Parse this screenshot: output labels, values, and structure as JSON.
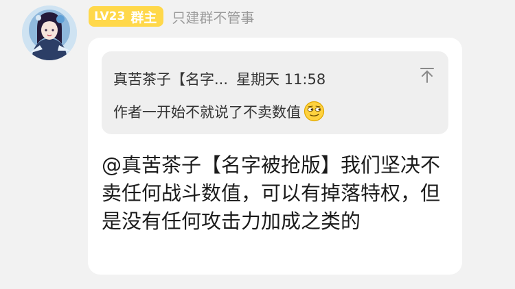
{
  "sender": {
    "avatar_icon": "anime-character-avatar-icon",
    "level": "LV23",
    "role": "群主",
    "nickname": "只建群不管事",
    "badge_color": "#ffd84a"
  },
  "reply_quote": {
    "author": "真苦茶子【名字...",
    "time": "星期天 11:58",
    "text": "作者一开始不就说了不卖数值",
    "emoji": "smirk-emoji-icon",
    "collapse_icon": "collapse-up-icon"
  },
  "message": {
    "text": "@真苦茶子【名字被抢版】我们坚决不卖任何战斗数值，可以有掉落特权，但是没有任何攻击力加成之类的"
  }
}
